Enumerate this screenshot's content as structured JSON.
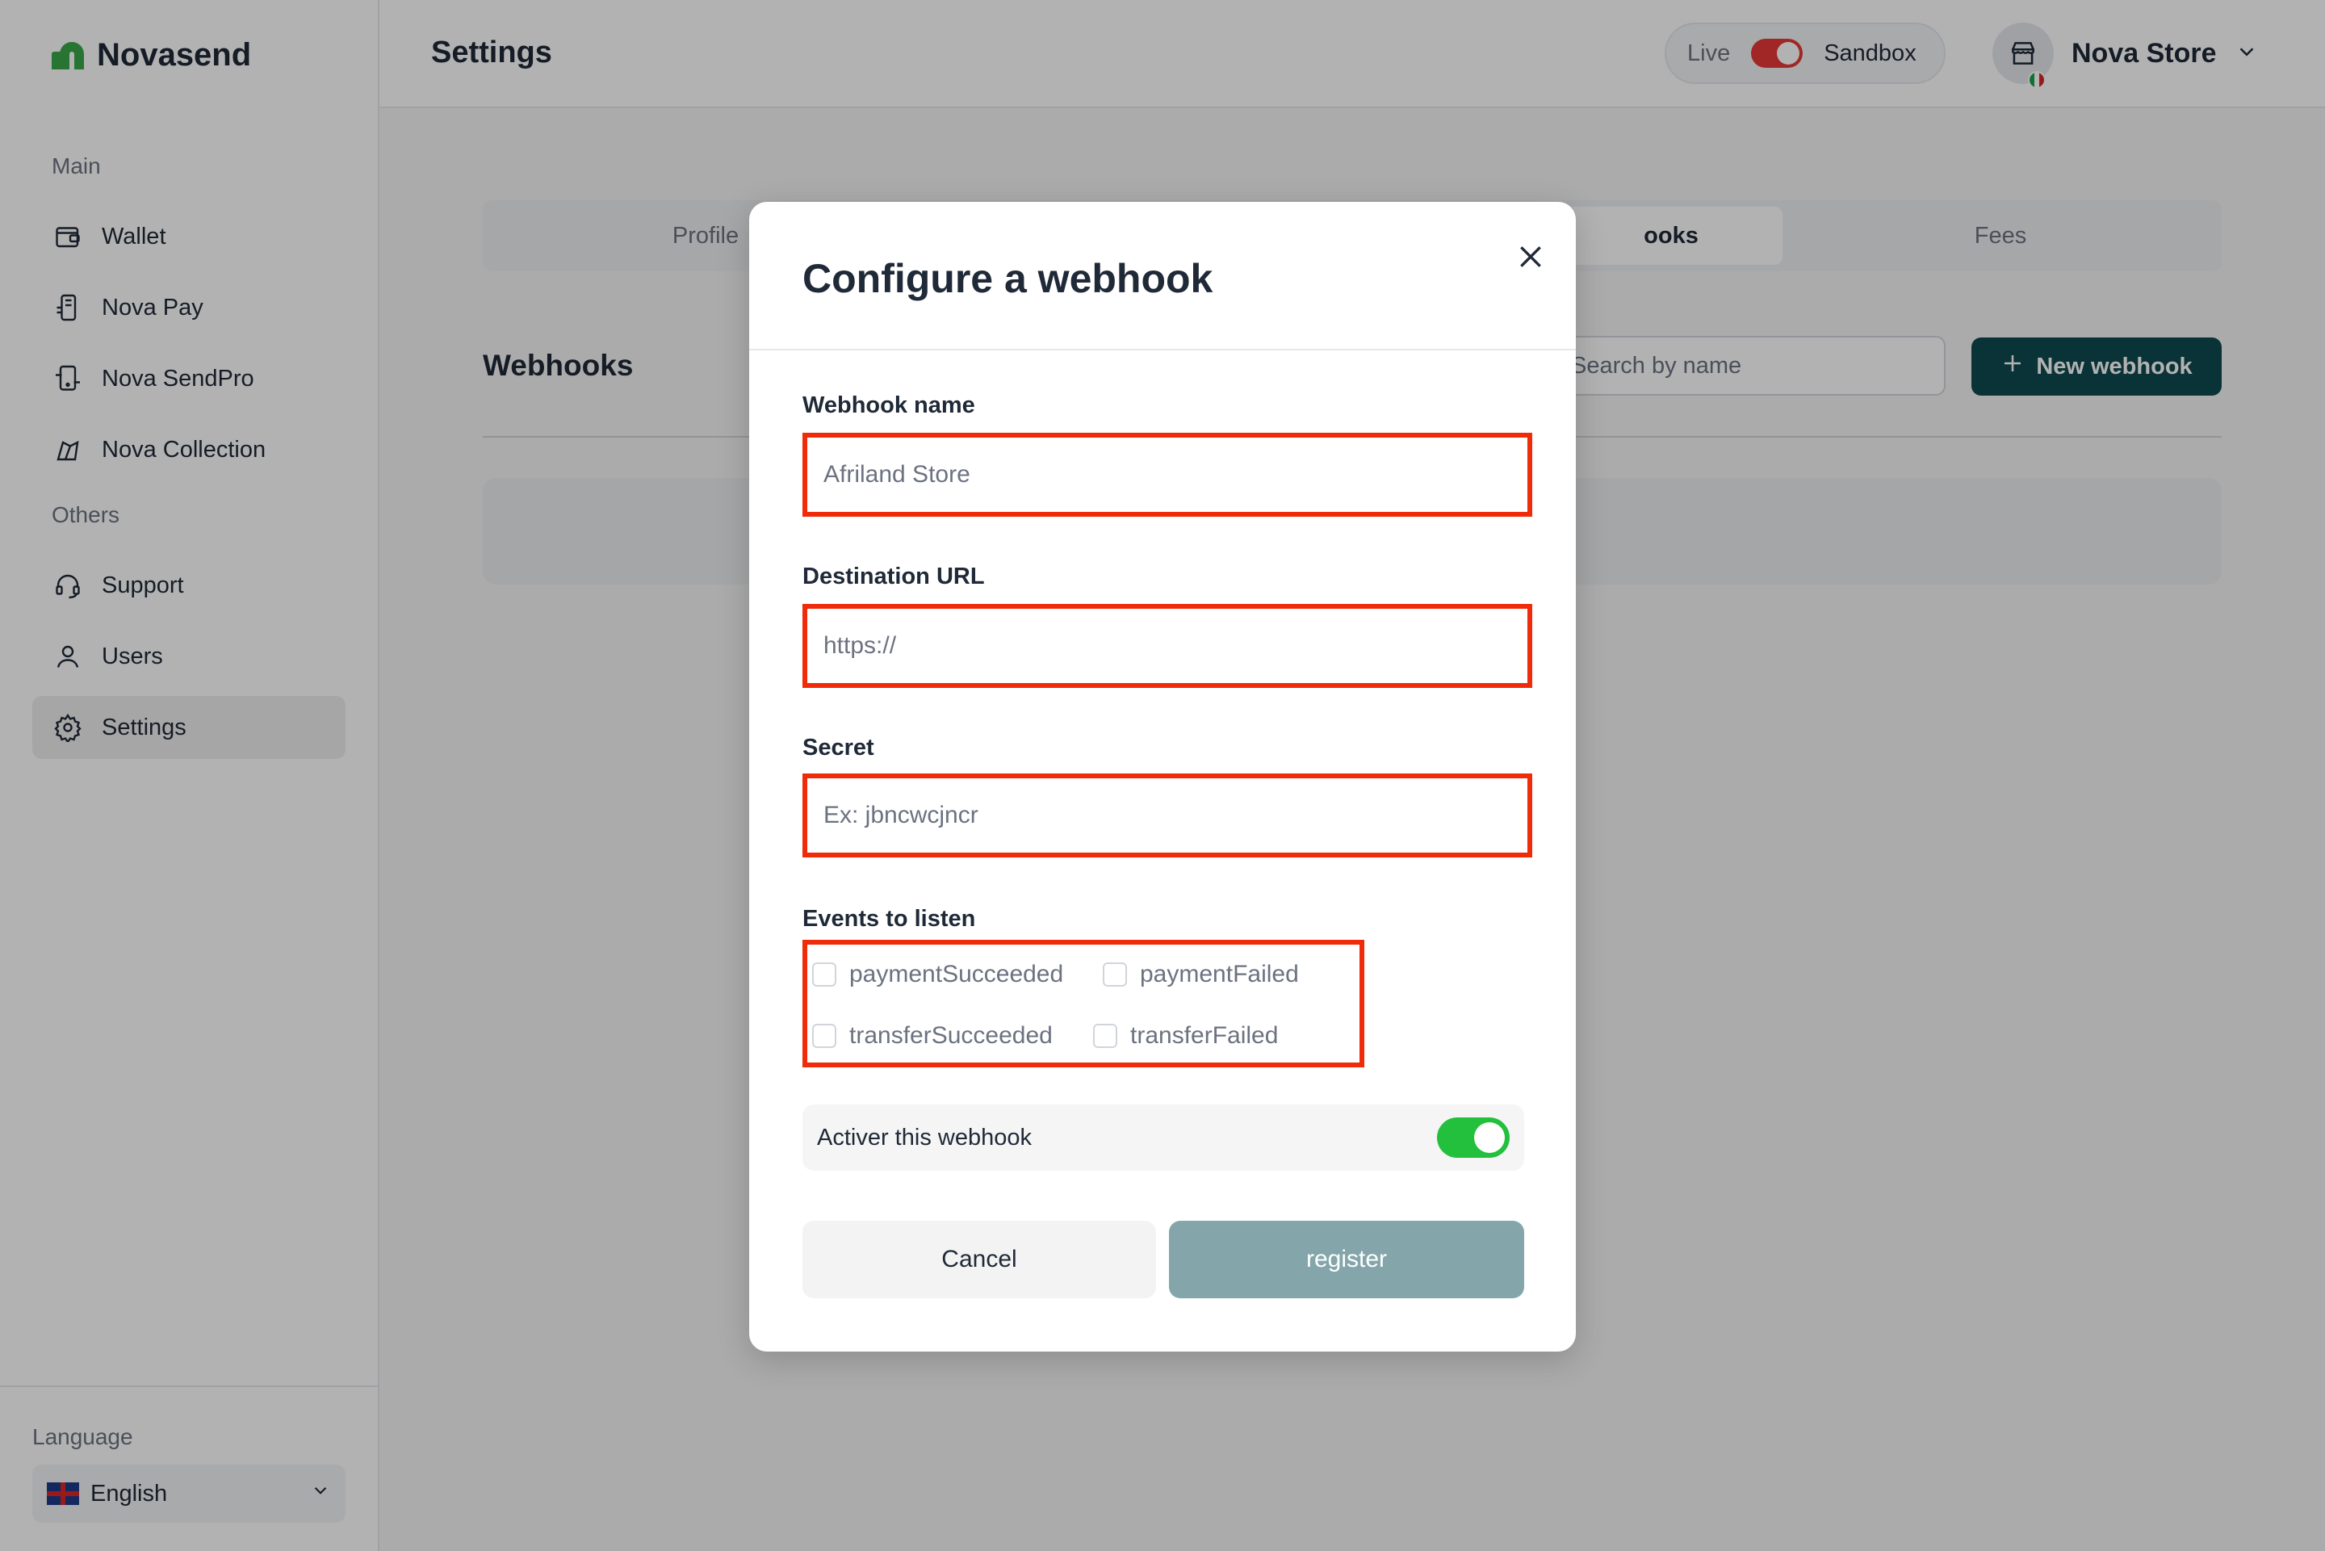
{
  "app": {
    "name": "Novasend"
  },
  "sidebar": {
    "main_label": "Main",
    "others_label": "Others",
    "main_items": [
      {
        "label": "Wallet",
        "icon": "wallet-icon"
      },
      {
        "label": "Nova Pay",
        "icon": "pos-terminal-icon"
      },
      {
        "label": "Nova SendPro",
        "icon": "mobile-transfer-icon"
      },
      {
        "label": "Nova Collection",
        "icon": "collection-icon"
      }
    ],
    "other_items": [
      {
        "label": "Support",
        "icon": "headset-icon"
      },
      {
        "label": "Users",
        "icon": "user-icon"
      },
      {
        "label": "Settings",
        "icon": "gear-icon",
        "active": true
      }
    ],
    "language_label": "Language",
    "language_value": "English"
  },
  "header": {
    "title": "Settings",
    "env_live": "Live",
    "env_sandbox": "Sandbox",
    "store_name": "Nova Store"
  },
  "tabs": [
    {
      "label": "Profile"
    },
    {
      "label": ""
    },
    {
      "label": "Webhooks",
      "visible_fragment": "ooks",
      "active": true
    },
    {
      "label": "Fees"
    }
  ],
  "webhooks_section": {
    "title": "Webhooks",
    "search_placeholder": "Search by name",
    "new_button_label": "New webhook"
  },
  "modal": {
    "title": "Configure a webhook",
    "fields": {
      "name": {
        "label": "Webhook name",
        "placeholder": "Afriland Store"
      },
      "url": {
        "label": "Destination URL",
        "placeholder": "https://"
      },
      "secret": {
        "label": "Secret",
        "placeholder": "Ex: jbncwcjncr"
      }
    },
    "events_label": "Events to listen",
    "events": [
      {
        "label": "paymentSucceeded",
        "checked": false
      },
      {
        "label": "paymentFailed",
        "checked": false
      },
      {
        "label": "transferSucceeded",
        "checked": false
      },
      {
        "label": "transferFailed",
        "checked": false
      }
    ],
    "activate_label": "Activer this webhook",
    "activate_on": true,
    "cancel_label": "Cancel",
    "register_label": "register"
  },
  "colors": {
    "brand_green": "#3aa64a",
    "primary_dark": "#0d4a4f",
    "register_disabled": "#84a6aa",
    "highlight_red": "#ef2b0a",
    "toggle_on": "#22c03c",
    "env_toggle_red": "#e53935"
  }
}
